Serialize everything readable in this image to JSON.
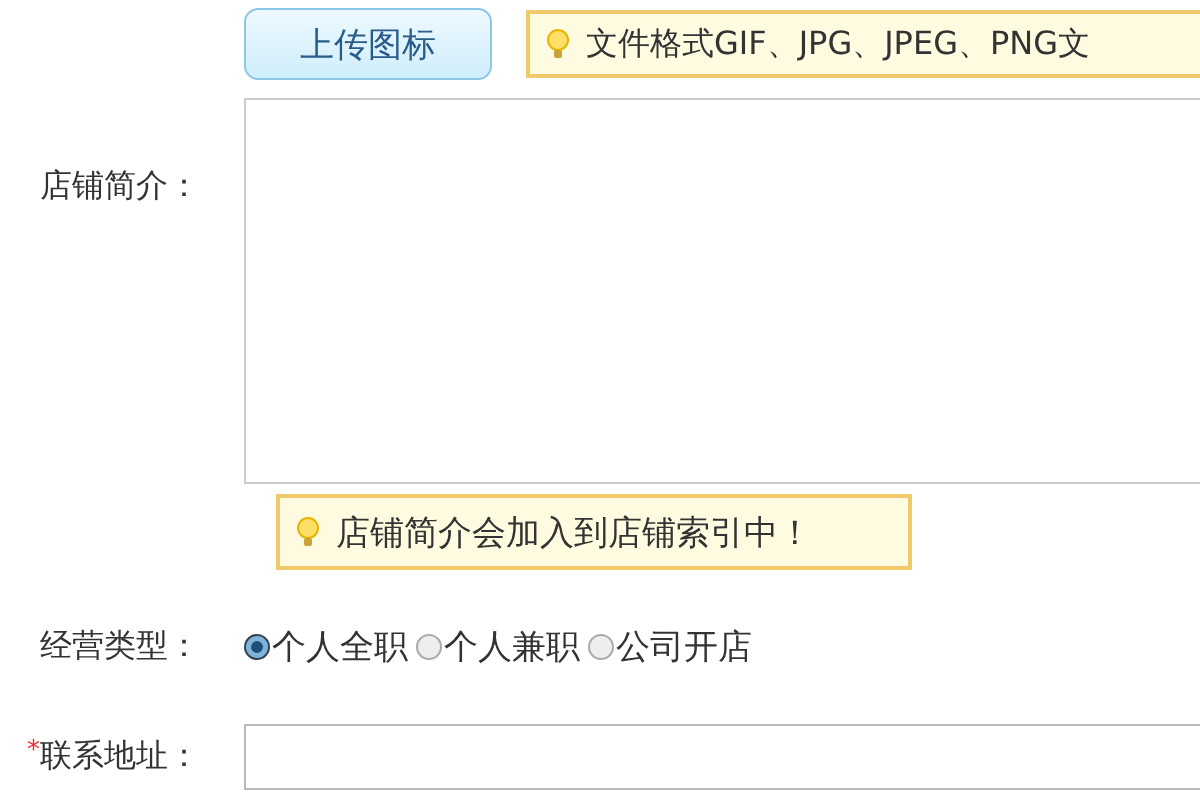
{
  "upload": {
    "button": "上传图标",
    "hint": "文件格式GIF、JPG、JPEG、PNG文"
  },
  "intro": {
    "label": "店铺简介：",
    "hint": "店铺简介会加入到店铺索引中！"
  },
  "business_type": {
    "label": "经营类型：",
    "options": [
      {
        "label": "个人全职",
        "selected": true
      },
      {
        "label": "个人兼职",
        "selected": false
      },
      {
        "label": "公司开店",
        "selected": false
      }
    ]
  },
  "address": {
    "label": "联系地址：",
    "required": true,
    "required_mark": "*"
  }
}
